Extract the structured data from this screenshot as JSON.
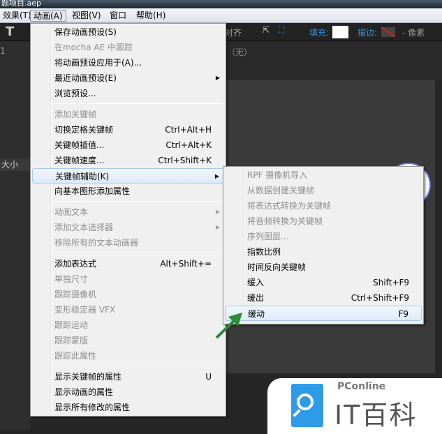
{
  "window": {
    "title": "题项目.aep"
  },
  "menubar": [
    "效果(T)",
    "动画(A)",
    "视图(V)",
    "窗口",
    "帮助(H)"
  ],
  "toolbar": {
    "align": "对齐",
    "fill_label": "填充:",
    "stroke_label": "描边:",
    "px_label": "- 像素",
    "text_tool": "T"
  },
  "panel": {
    "none_label": "（无）",
    "size_label": "大小",
    "num": "1"
  },
  "main_menu": [
    {
      "label": "保存动画预设(S)",
      "enabled": true
    },
    {
      "label": "在mocha AE 中跟踪",
      "enabled": false
    },
    {
      "label": "将动画预设应用于(A)...",
      "enabled": true
    },
    {
      "label": "最近动画预设(E)",
      "enabled": true,
      "submenu": true
    },
    {
      "label": "浏览预设...",
      "enabled": true
    },
    {
      "sep": true
    },
    {
      "label": "添加关键帧",
      "enabled": false
    },
    {
      "label": "切换定格关键帧",
      "shortcut": "Ctrl+Alt+H",
      "enabled": true
    },
    {
      "label": "关键帧插值...",
      "shortcut": "Ctrl+Alt+K",
      "enabled": true
    },
    {
      "label": "关键帧速度...",
      "shortcut": "Ctrl+Shift+K",
      "enabled": true
    },
    {
      "label": "关键帧辅助(K)",
      "enabled": true,
      "submenu": true,
      "highlight": true
    },
    {
      "label": "向基本图形添加属性",
      "enabled": true
    },
    {
      "sep": true
    },
    {
      "label": "动画文本",
      "enabled": false,
      "submenu": true
    },
    {
      "label": "添加文本选择器",
      "enabled": false,
      "submenu": true
    },
    {
      "label": "移除所有的文本动画器",
      "enabled": false
    },
    {
      "sep": true
    },
    {
      "label": "添加表达式",
      "shortcut": "Alt+Shift+=",
      "enabled": true
    },
    {
      "label": "单独尺寸",
      "enabled": false
    },
    {
      "label": "跟踪摄像机",
      "enabled": false
    },
    {
      "label": "变形稳定器 VFX",
      "enabled": false
    },
    {
      "label": "跟踪运动",
      "enabled": false
    },
    {
      "label": "跟踪蒙版",
      "enabled": false
    },
    {
      "label": "跟踪此属性",
      "enabled": false
    },
    {
      "sep": true
    },
    {
      "label": "显示关键帧的属性",
      "shortcut": "U",
      "enabled": true
    },
    {
      "label": "显示动画的属性",
      "enabled": true
    },
    {
      "label": "显示所有修改的属性",
      "enabled": true
    }
  ],
  "sub_menu": [
    {
      "label": "RPF 摄像机导入",
      "enabled": false
    },
    {
      "label": "从数据创建关键帧",
      "enabled": false
    },
    {
      "label": "将表达式转换为关键帧",
      "enabled": false
    },
    {
      "label": "将音频转换为关键帧",
      "enabled": false
    },
    {
      "label": "序列图层...",
      "enabled": false
    },
    {
      "label": "指数比例",
      "enabled": true
    },
    {
      "label": "时间反向关键帧",
      "enabled": true
    },
    {
      "label": "缓入",
      "shortcut": "Shift+F9",
      "enabled": true
    },
    {
      "label": "缓出",
      "shortcut": "Ctrl+Shift+F9",
      "enabled": true
    },
    {
      "label": "缓动",
      "shortcut": "F9",
      "enabled": true,
      "highlight": true
    }
  ],
  "watermark": {
    "brand": "PConline",
    "name": "IT百科"
  },
  "colors": {
    "accent": "#2d9be8",
    "arrow": "#2e8b3a",
    "toolbar_label": "#3b8fe0"
  }
}
